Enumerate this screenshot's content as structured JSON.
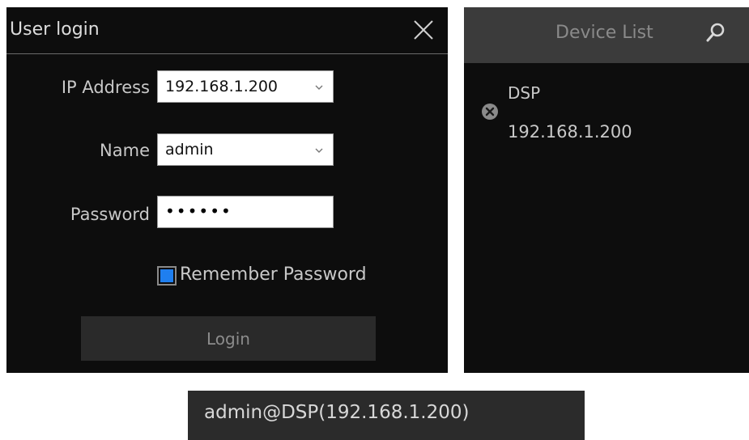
{
  "login": {
    "title": "User login",
    "ip_label": "IP Address",
    "ip_value": "192.168.1.200",
    "name_label": "Name",
    "name_value": "admin",
    "password_label": "Password",
    "password_masked": "••••••",
    "remember_label": "Remember Password",
    "remember_checked": true,
    "login_button": "Login",
    "close_icon": "close-icon"
  },
  "device_list": {
    "title": "Device List",
    "search_icon": "search-icon",
    "items": [
      {
        "name": "DSP",
        "ip": "192.168.1.200",
        "status_icon": "disconnected-icon"
      }
    ]
  },
  "status_bar": {
    "text": "admin@DSP(192.168.1.200)"
  },
  "colors": {
    "panel_bg": "#0d0d0d",
    "header_bg": "#3b3b3b",
    "checkbox_accent": "#1f7ff0",
    "button_bg": "#2a2a2a"
  }
}
